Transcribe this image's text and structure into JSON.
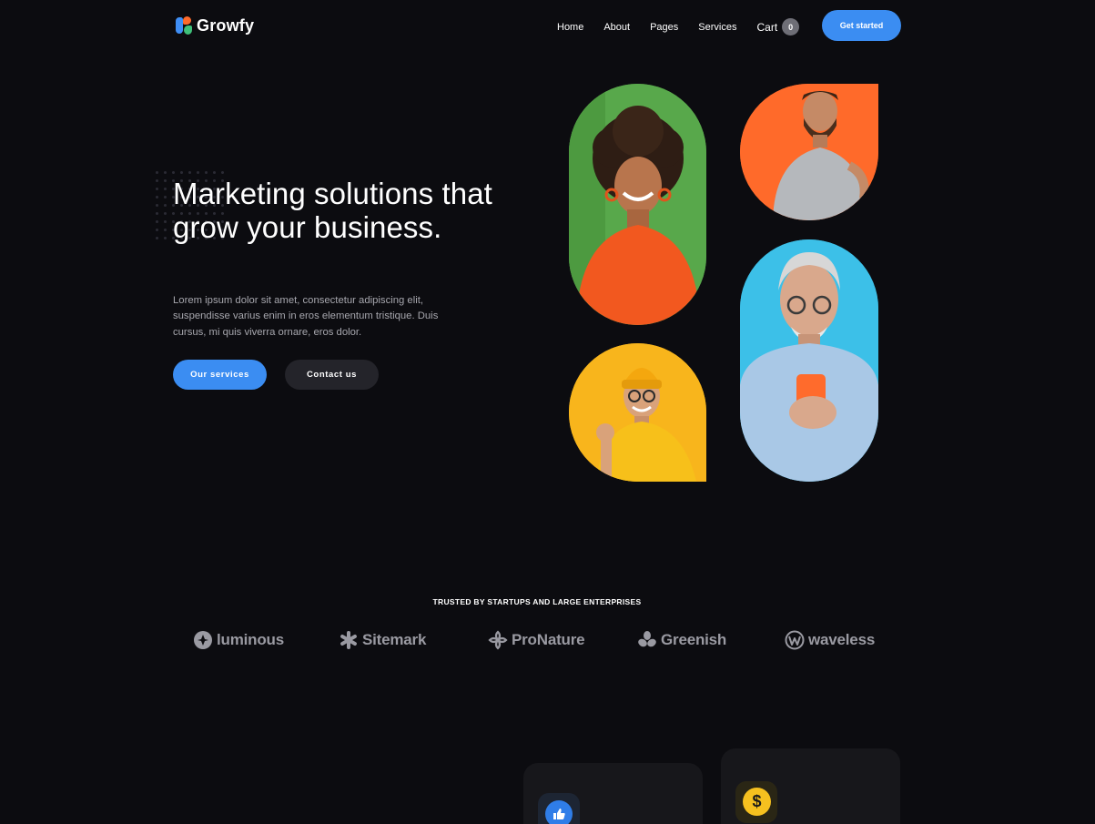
{
  "nav": {
    "logo_text": "Growfy",
    "links": [
      "Home",
      "About",
      "Pages",
      "Services"
    ],
    "cart_label": "Cart",
    "cart_count": "0",
    "cta_label": "Get started"
  },
  "hero": {
    "title": "Marketing solutions that grow your business.",
    "description": "Lorem ipsum dolor sit amet, consectetur adipiscing elit, suspendisse varius enim in eros elementum tristique. Duis cursus, mi quis viverra ornare, eros dolor.",
    "primary_button": "Our services",
    "secondary_button": "Contact us"
  },
  "photos": [
    {
      "subject": "woman-orange-shirt",
      "bg": "#58a84b"
    },
    {
      "subject": "man-grey-shirt",
      "bg": "#ff6a2a"
    },
    {
      "subject": "man-yellow-beanie",
      "bg": "#f8b51c"
    },
    {
      "subject": "older-man-phone",
      "bg": "#3cc0e8"
    }
  ],
  "trusted": {
    "title": "TRUSTED BY STARTUPS AND LARGE ENTERPRISES",
    "brands": [
      "luminous",
      "Sitemark",
      "ProNature",
      "Greenish",
      "waveless"
    ]
  },
  "feature_cards": [
    {
      "icon": "thumbs-up-icon",
      "color": "#2f7de8"
    },
    {
      "icon": "dollar-icon",
      "glyph": "$",
      "color": "#f5c01f"
    }
  ],
  "colors": {
    "background": "#0c0c10",
    "accent": "#3b8df2",
    "secondary_button": "#24242a"
  }
}
